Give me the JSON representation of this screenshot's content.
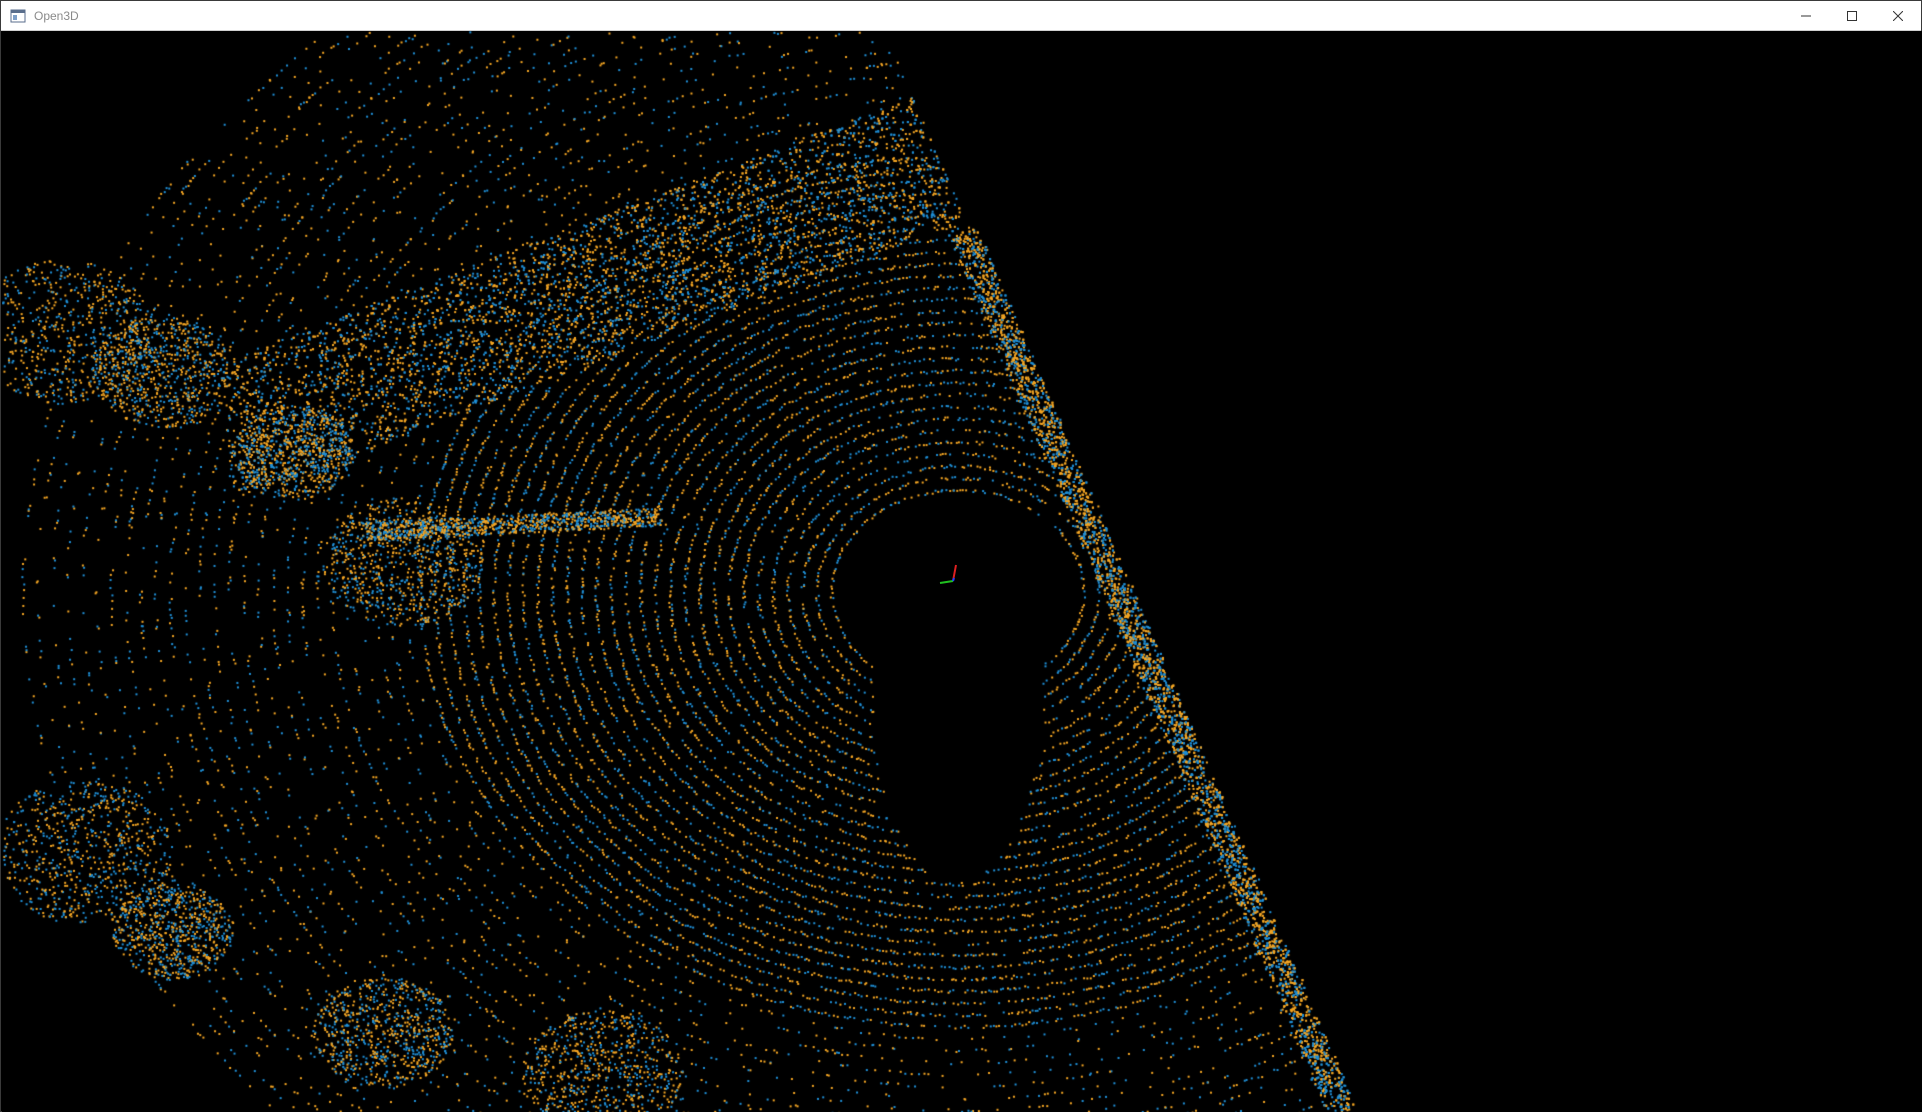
{
  "window": {
    "title": "Open3D",
    "app_icon": "open3d-window-icon",
    "controls": {
      "minimize_icon": "minimize-icon",
      "maximize_icon": "maximize-icon",
      "close_icon": "close-icon"
    }
  },
  "viewer": {
    "background_color": "#000000",
    "point_colors": [
      "#f5a623",
      "#1f8fd6"
    ],
    "axis_colors": {
      "x": "#e02020",
      "y": "#20c020",
      "z": "#2040ff"
    }
  }
}
